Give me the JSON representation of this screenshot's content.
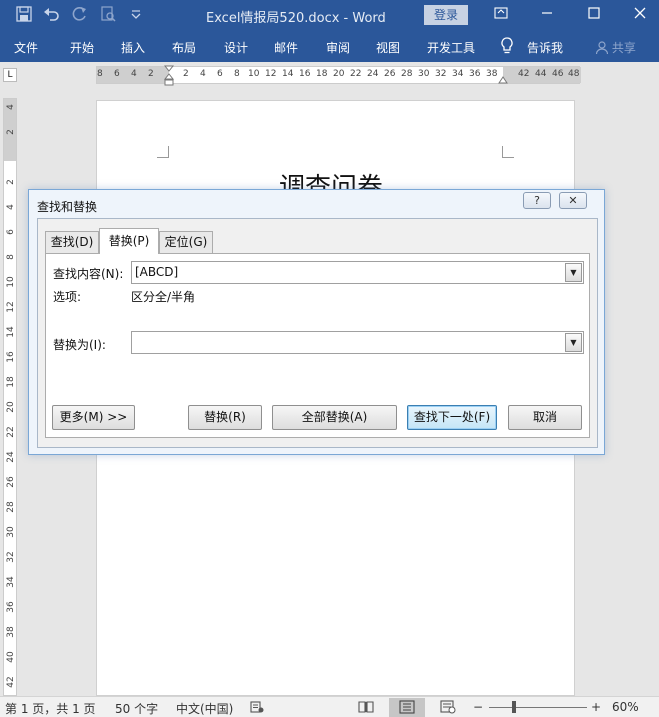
{
  "window": {
    "title": "Excel情报局520.docx  -  Word",
    "login_label": "登录",
    "controls": [
      "restore-ribbon-icon",
      "minimize-icon",
      "maximize-icon",
      "close-icon"
    ]
  },
  "quick_access": [
    "save-icon",
    "undo-icon",
    "redo-icon",
    "print-preview-icon",
    "customize-qat-icon"
  ],
  "ribbon": {
    "tabs": [
      "文件",
      "开始",
      "插入",
      "布局",
      "设计",
      "邮件",
      "审阅",
      "视图",
      "开发工具"
    ],
    "tell_me": "告诉我",
    "share": "共享"
  },
  "ruler": {
    "h_left": [
      "8",
      "6",
      "4",
      "2"
    ],
    "h_right": [
      "2",
      "4",
      "6",
      "8",
      "10",
      "12",
      "14",
      "16",
      "18",
      "20",
      "22",
      "24",
      "26",
      "28",
      "30",
      "32",
      "34",
      "36",
      "38"
    ],
    "h_far": [
      "42",
      "44",
      "46",
      "48"
    ],
    "v_top": [
      "4",
      "2"
    ],
    "v_marks": [
      "2",
      "4",
      "6",
      "8",
      "10",
      "12",
      "14",
      "16",
      "18",
      "20",
      "22",
      "24",
      "26",
      "28",
      "30",
      "32",
      "34",
      "36",
      "38",
      "40",
      "42"
    ]
  },
  "document": {
    "heading": "调查问卷"
  },
  "dialog": {
    "title": "查找和替换",
    "help_label": "?",
    "close_label": "✕",
    "tabs": {
      "find": "查找(D)",
      "replace": "替换(P)",
      "goto": "定位(G)"
    },
    "find_label": "查找内容(N):",
    "find_value": "[ABCD]",
    "options_label": "选项:",
    "options_value": "区分全/半角",
    "replace_label": "替换为(I):",
    "replace_value": "",
    "buttons": {
      "more": "更多(M) >>",
      "replace": "替换(R)",
      "replace_all": "全部替换(A)",
      "find_next": "查找下一处(F)",
      "cancel": "取消"
    }
  },
  "status": {
    "page": "第 1 页，共 1 页",
    "words": "50 个字",
    "language": "中文(中国)",
    "zoom": "60%",
    "zoom_minus": "−",
    "zoom_plus": "+"
  },
  "colors": {
    "title_bar": "#2b579a",
    "dialog_border": "#7aa7d6",
    "default_button": "#3c7fb1"
  }
}
